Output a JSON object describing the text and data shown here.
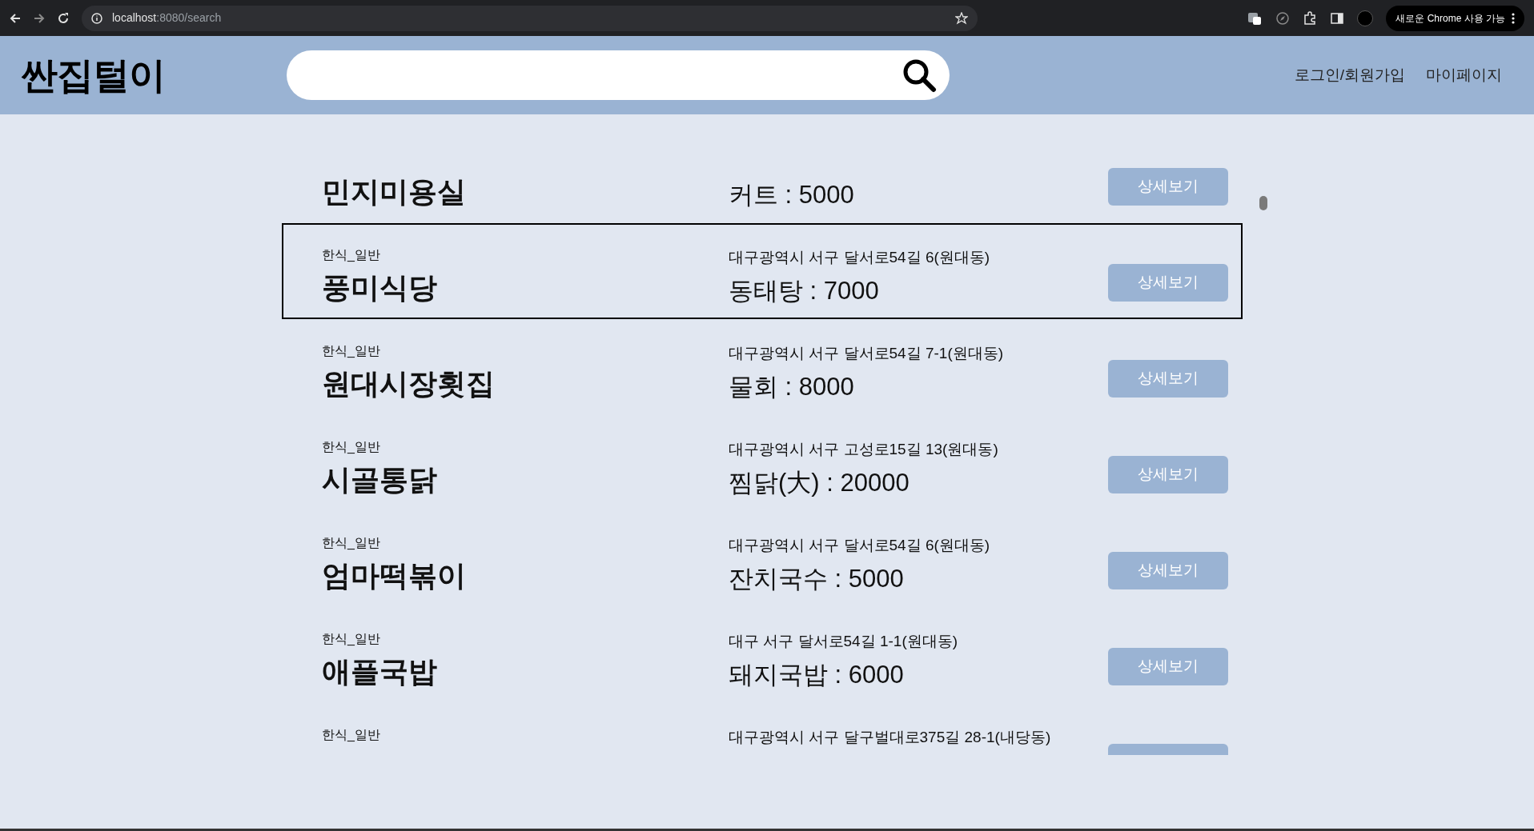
{
  "browser": {
    "url_host": "localhost",
    "url_rest": ":8080/search",
    "update_badge": "새로운 Chrome 사용 가능"
  },
  "header": {
    "logo": "싼집털이",
    "nav": [
      "로그인/회원가입",
      "마이페이지"
    ]
  },
  "results": [
    {
      "name": "민지미용실",
      "price": "커트 : 5000",
      "button": "상세보기",
      "selected": false
    },
    {
      "category": "한식_일반",
      "name": "풍미식당",
      "address": "대구광역시 서구 달서로54길 6(원대동)",
      "price": "동태탕 : 7000",
      "button": "상세보기",
      "selected": true
    },
    {
      "category": "한식_일반",
      "name": "원대시장횟집",
      "address": "대구광역시 서구 달서로54길 7-1(원대동)",
      "price": "물회 : 8000",
      "button": "상세보기",
      "selected": false
    },
    {
      "category": "한식_일반",
      "name": "시골통닭",
      "address": "대구광역시 서구 고성로15길 13(원대동)",
      "price": "찜닭(大) : 20000",
      "button": "상세보기",
      "selected": false
    },
    {
      "category": "한식_일반",
      "name": "엄마떡볶이",
      "address": "대구광역시 서구 달서로54길 6(원대동)",
      "price": "잔치국수 : 5000",
      "button": "상세보기",
      "selected": false
    },
    {
      "category": "한식_일반",
      "name": "애플국밥",
      "address": "대구 서구 달서로54길 1-1(원대동)",
      "price": "돼지국밥 : 6000",
      "button": "상세보기",
      "selected": false
    },
    {
      "category": "한식_일반",
      "address": "대구광역시 서구 달구벌대로375길 28-1(내당동)",
      "selected": false
    }
  ]
}
